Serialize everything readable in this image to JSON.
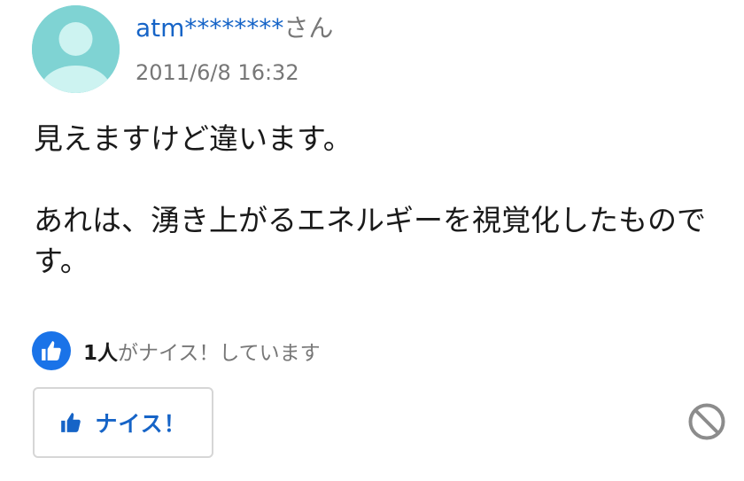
{
  "answer": {
    "author": {
      "name": "atm********",
      "suffix": "さん",
      "avatar": "default-user-avatar"
    },
    "timestamp": "2011/6/8 16:32",
    "body": {
      "paragraph1": "見えますけど違います。",
      "paragraph2": "あれは、湧き上がるエネルギーを視覚化したものです。"
    },
    "reactions": {
      "count": "1人",
      "text": "がナイス！しています",
      "icon": "thumbs-up-icon"
    },
    "actions": {
      "nice_label": "ナイス！",
      "nice_icon": "thumbs-up-icon",
      "report_icon": "prohibited-icon"
    }
  },
  "colors": {
    "link": "#1664c7",
    "accent": "#1a73e8",
    "muted": "#777777",
    "avatar_bg": "#7fd3d3",
    "avatar_fg": "#cdf3f1"
  }
}
